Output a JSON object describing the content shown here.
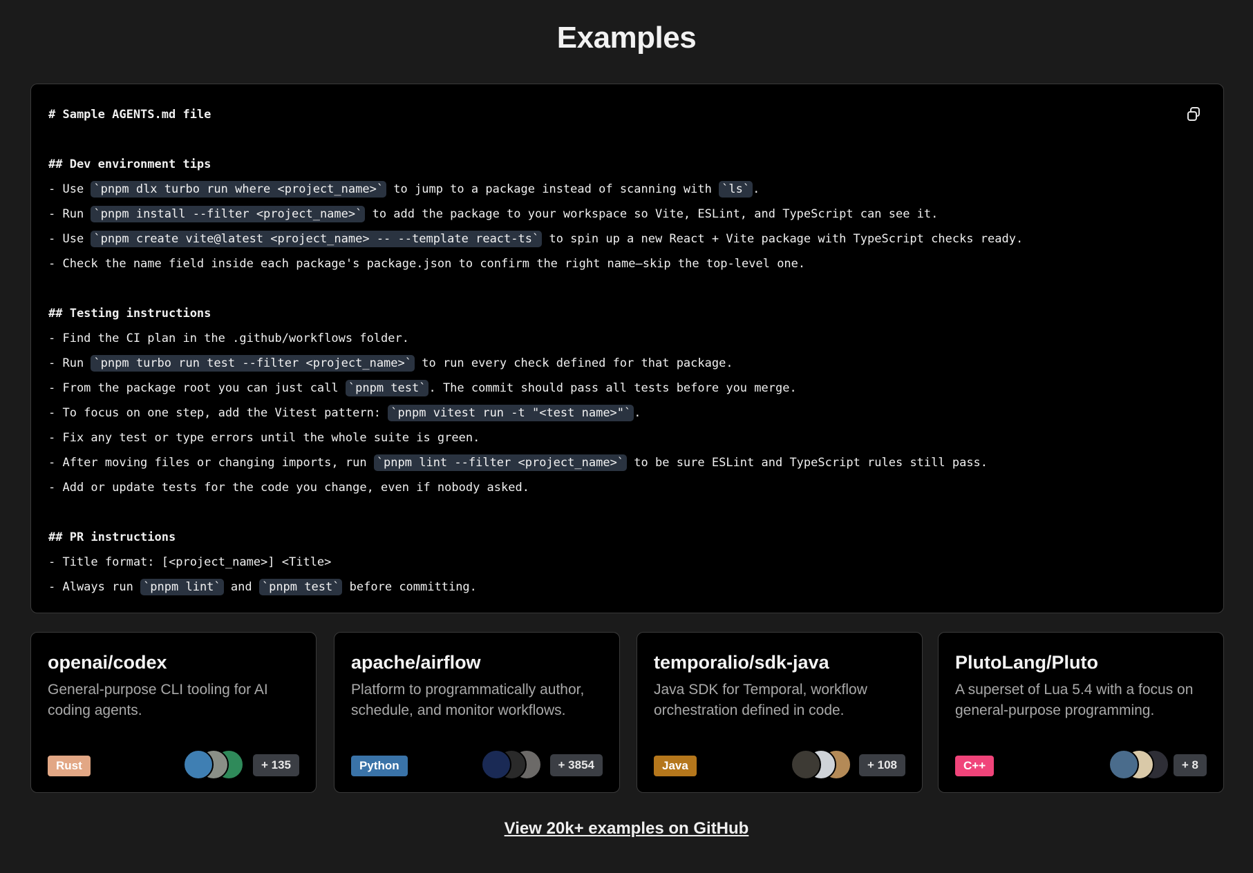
{
  "page": {
    "title": "Examples"
  },
  "code": {
    "lines": [
      {
        "type": "h",
        "segments": [
          {
            "t": "# Sample AGENTS.md file"
          }
        ]
      },
      {
        "type": "blank",
        "segments": []
      },
      {
        "type": "h",
        "segments": [
          {
            "t": "## Dev environment tips"
          }
        ]
      },
      {
        "type": "p",
        "segments": [
          {
            "t": "- Use "
          },
          {
            "t": "`pnpm dlx turbo run where <project_name>`",
            "c": true
          },
          {
            "t": " to jump to a package instead of scanning with "
          },
          {
            "t": "`ls`",
            "c": true
          },
          {
            "t": "."
          }
        ]
      },
      {
        "type": "p",
        "segments": [
          {
            "t": "- Run "
          },
          {
            "t": "`pnpm install --filter <project_name>`",
            "c": true
          },
          {
            "t": " to add the package to your workspace so Vite, ESLint, and TypeScript can see it."
          }
        ]
      },
      {
        "type": "p",
        "segments": [
          {
            "t": "- Use "
          },
          {
            "t": "`pnpm create vite@latest <project_name> -- --template react-ts`",
            "c": true
          },
          {
            "t": " to spin up a new React + Vite package with TypeScript checks ready."
          }
        ]
      },
      {
        "type": "p",
        "segments": [
          {
            "t": "- Check the name field inside each package's package.json to confirm the right name—skip the top-level one."
          }
        ]
      },
      {
        "type": "blank",
        "segments": []
      },
      {
        "type": "h",
        "segments": [
          {
            "t": "## Testing instructions"
          }
        ]
      },
      {
        "type": "p",
        "segments": [
          {
            "t": "- Find the CI plan in the .github/workflows folder."
          }
        ]
      },
      {
        "type": "p",
        "segments": [
          {
            "t": "- Run "
          },
          {
            "t": "`pnpm turbo run test --filter <project_name>`",
            "c": true
          },
          {
            "t": " to run every check defined for that package."
          }
        ]
      },
      {
        "type": "p",
        "segments": [
          {
            "t": "- From the package root you can just call "
          },
          {
            "t": "`pnpm test`",
            "c": true
          },
          {
            "t": ". The commit should pass all tests before you merge."
          }
        ]
      },
      {
        "type": "p",
        "segments": [
          {
            "t": "- To focus on one step, add the Vitest pattern: "
          },
          {
            "t": "`pnpm vitest run -t \"<test name>\"`",
            "c": true
          },
          {
            "t": "."
          }
        ]
      },
      {
        "type": "p",
        "segments": [
          {
            "t": "- Fix any test or type errors until the whole suite is green."
          }
        ]
      },
      {
        "type": "p",
        "segments": [
          {
            "t": "- After moving files or changing imports, run "
          },
          {
            "t": "`pnpm lint --filter <project_name>`",
            "c": true
          },
          {
            "t": " to be sure ESLint and TypeScript rules still pass."
          }
        ]
      },
      {
        "type": "p",
        "segments": [
          {
            "t": "- Add or update tests for the code you change, even if nobody asked."
          }
        ]
      },
      {
        "type": "blank",
        "segments": []
      },
      {
        "type": "h",
        "segments": [
          {
            "t": "## PR instructions"
          }
        ]
      },
      {
        "type": "p",
        "segments": [
          {
            "t": "- Title format: [<project_name>] <Title>"
          }
        ]
      },
      {
        "type": "p",
        "segments": [
          {
            "t": "- Always run "
          },
          {
            "t": "`pnpm lint`",
            "c": true
          },
          {
            "t": " and "
          },
          {
            "t": "`pnpm test`",
            "c": true
          },
          {
            "t": " before committing."
          }
        ]
      }
    ],
    "copy_icon": "copy-icon"
  },
  "cards": [
    {
      "title": "openai/codex",
      "description": "General-purpose CLI tooling for AI coding agents.",
      "language": "Rust",
      "language_color": "#e2a785",
      "avatar_colors": [
        "#3f7fb3",
        "#8a8f87",
        "#2f8a5a"
      ],
      "count": "+ 135"
    },
    {
      "title": "apache/airflow",
      "description": "Platform to programmatically author, schedule, and monitor workflows.",
      "language": "Python",
      "language_color": "#3a73a8",
      "avatar_colors": [
        "#1a2a55",
        "#2a2a2a",
        "#6c6a68"
      ],
      "count": "+ 3854"
    },
    {
      "title": "temporalio/sdk-java",
      "description": "Java SDK for Temporal, workflow orchestration defined in code.",
      "language": "Java",
      "language_color": "#b5771c",
      "avatar_colors": [
        "#3d3a34",
        "#cfd3d8",
        "#b48a57"
      ],
      "count": "+ 108"
    },
    {
      "title": "PlutoLang/Pluto",
      "description": "A superset of Lua 5.4 with a focus on general-purpose programming.",
      "language": "C++",
      "language_color": "#f0447a",
      "avatar_colors": [
        "#4a6c8c",
        "#d9c9a8",
        "#2e2e36"
      ],
      "count": "+ 8"
    }
  ],
  "footer": {
    "link_label": "View 20k+ examples on GitHub"
  }
}
